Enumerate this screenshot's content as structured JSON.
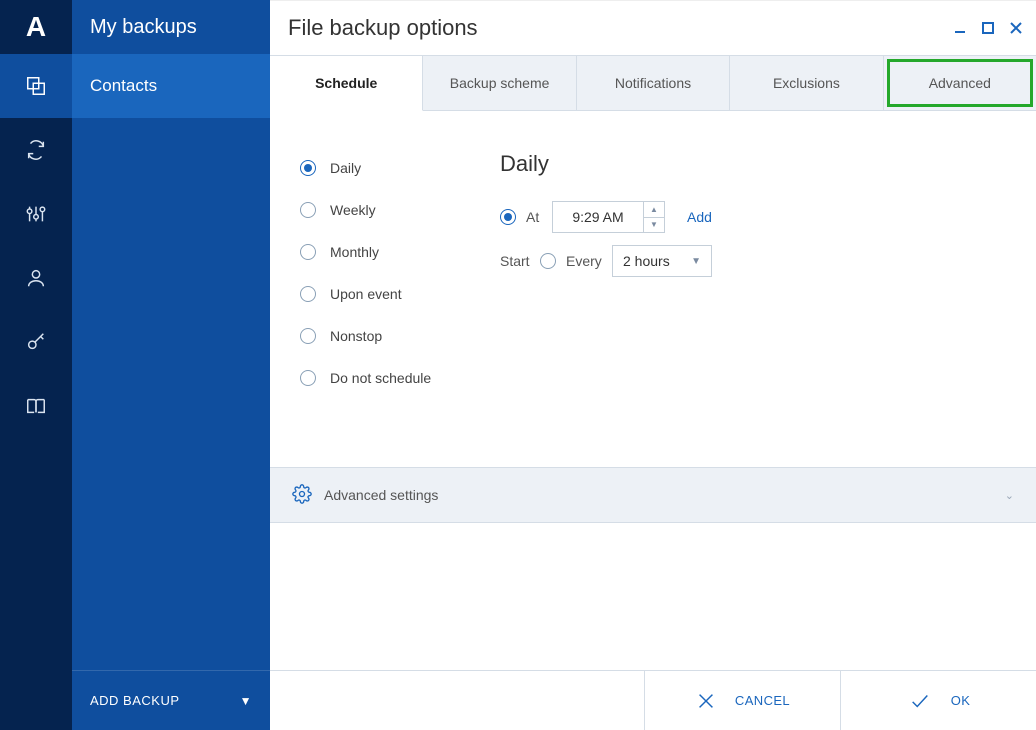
{
  "logo": "A",
  "sidebar": {
    "header": "My backups",
    "items": [
      {
        "label": "Contacts"
      }
    ],
    "add_backup": "ADD BACKUP"
  },
  "main": {
    "title": "File backup options",
    "tabs": [
      {
        "label": "Schedule"
      },
      {
        "label": "Backup scheme"
      },
      {
        "label": "Notifications"
      },
      {
        "label": "Exclusions"
      },
      {
        "label": "Advanced"
      }
    ],
    "schedule": {
      "options": [
        {
          "label": "Daily"
        },
        {
          "label": "Weekly"
        },
        {
          "label": "Monthly"
        },
        {
          "label": "Upon event"
        },
        {
          "label": "Nonstop"
        },
        {
          "label": "Do not schedule"
        }
      ],
      "detail": {
        "heading": "Daily",
        "at_label": "At",
        "at_value": "9:29 AM",
        "add_label": "Add",
        "start_label": "Start",
        "every_label": "Every",
        "every_value": "2 hours"
      }
    },
    "advanced_settings": "Advanced settings",
    "footer": {
      "cancel": "CANCEL",
      "ok": "OK"
    }
  }
}
